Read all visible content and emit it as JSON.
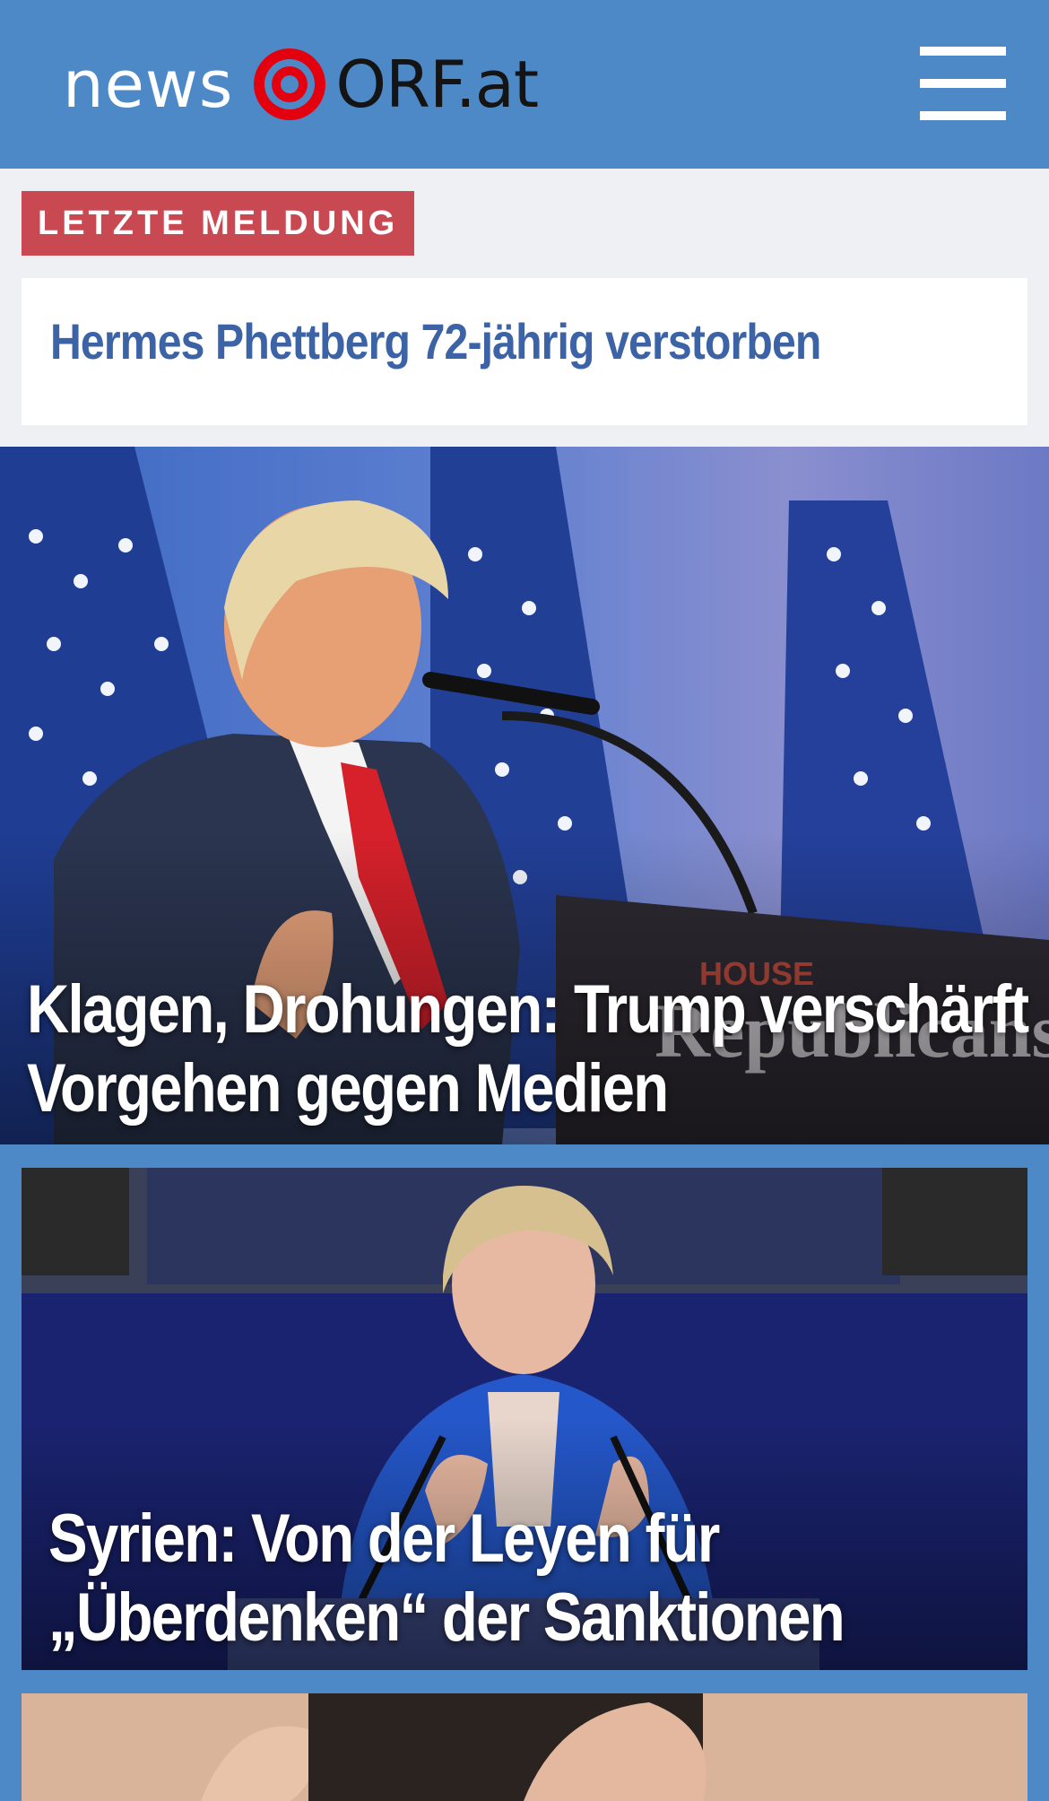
{
  "header": {
    "logo_news": "news",
    "logo_orf": "ORF.at",
    "menu_icon": "hamburger-menu-icon",
    "background": "#4e89c7"
  },
  "breaking": {
    "badge": "LETZTE MELDUNG",
    "headline": "Hermes Phettberg 72-jährig verstorben",
    "badge_color": "#c94952",
    "headline_color": "#3c63a6"
  },
  "stories": [
    {
      "title_line1": "Klagen, Drohungen: Trump verschärft",
      "title_line2": "Vorgehen gegen Medien"
    },
    {
      "title_line1": "Syrien: Von der Leyen für",
      "title_line2": "„Überdenken“ der Sanktionen"
    }
  ]
}
